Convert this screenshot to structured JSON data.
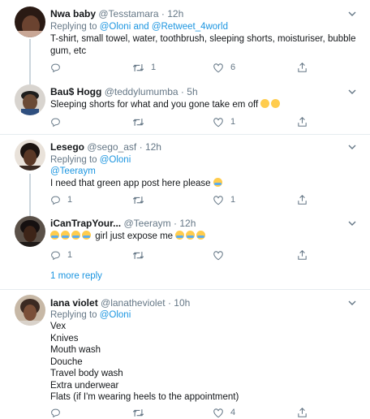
{
  "tweets": [
    {
      "name": "Nwa baby",
      "handle": "@Tesstamara",
      "time": "12h",
      "replying_prefix": "Replying to ",
      "replying_to": "@Oloni and @Retweet_4world",
      "text": "T-shirt, small towel, water, toothbrush, sleeping shorts, moisturiser, bubble gum, etc",
      "retweets": "1",
      "likes": "6"
    },
    {
      "name": "Bau$ Hogg",
      "handle": "@teddylumumba",
      "time": "5h",
      "text": "Sleeping shorts for what and you gone take em off",
      "retweets": "",
      "likes": "1"
    },
    {
      "name": "Lesego",
      "handle": "@sego_asf",
      "time": "12h",
      "replying_prefix": "Replying to ",
      "replying_to": "@Oloni",
      "mention": "@Teeraym",
      "text": "I need that green app post here please",
      "replies": "1",
      "retweets": "",
      "likes": "1"
    },
    {
      "name": "iCanTrapYour...",
      "handle": "@Teeraym",
      "time": "12h",
      "text_mid": "girl just expose me",
      "replies": "1",
      "retweets": "",
      "likes": ""
    },
    {
      "name": "Iana violet",
      "handle": "@lanatheviolet",
      "time": "10h",
      "replying_prefix": "Replying to ",
      "replying_to": "@Oloni",
      "lines": [
        "Vex",
        "Knives",
        "Mouth wash",
        "Douche",
        "Travel body wash",
        "Extra underwear",
        "Flats (if I'm wearing heels to the appointment)"
      ],
      "retweets": "",
      "likes": "4"
    }
  ],
  "more_replies": "1 more reply",
  "dot": "·",
  "colors": {
    "link": "#1b95e0",
    "muted": "#657786",
    "divider": "#e6ecf0"
  },
  "icons": [
    "reply-icon",
    "retweet-icon",
    "like-icon",
    "share-icon",
    "chevron-down-icon"
  ]
}
